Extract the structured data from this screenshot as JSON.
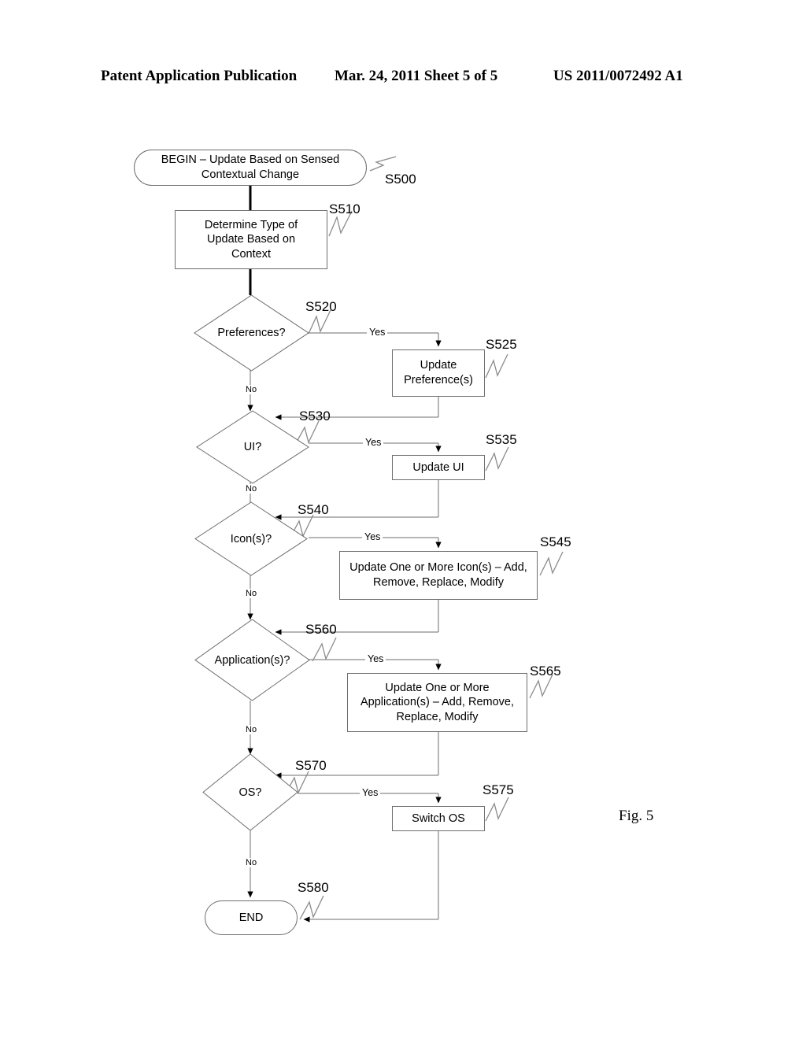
{
  "header": {
    "title": "Patent Application Publication",
    "date_sheet": "Mar. 24, 2011  Sheet 5 of 5",
    "publication_number": "US 2011/0072492 A1"
  },
  "figure": {
    "label": "Fig. 5"
  },
  "flowchart": {
    "nodes": {
      "begin": {
        "label": "BEGIN – Update Based on Sensed Contextual Change",
        "ref": "S500",
        "shape": "terminator"
      },
      "determine": {
        "label": "Determine Type of Update Based on Context",
        "ref": "S510",
        "shape": "process"
      },
      "preferences_decision": {
        "label": "Preferences?",
        "ref": "S520",
        "shape": "decision"
      },
      "update_preferences": {
        "label": "Update Preference(s)",
        "ref": "S525",
        "shape": "process"
      },
      "ui_decision": {
        "label": "UI?",
        "ref": "S530",
        "shape": "decision"
      },
      "update_ui": {
        "label": "Update UI",
        "ref": "S535",
        "shape": "process"
      },
      "icons_decision": {
        "label": "Icon(s)?",
        "ref": "S540",
        "shape": "decision"
      },
      "update_icons": {
        "label": "Update One or More Icon(s) – Add, Remove, Replace, Modify",
        "ref": "S545",
        "shape": "process"
      },
      "applications_decision": {
        "label": "Application(s)?",
        "ref": "S560",
        "shape": "decision"
      },
      "update_applications": {
        "label": "Update One or More Application(s) – Add, Remove, Replace, Modify",
        "ref": "S565",
        "shape": "process"
      },
      "os_decision": {
        "label": "OS?",
        "ref": "S570",
        "shape": "decision"
      },
      "switch_os": {
        "label": "Switch OS",
        "ref": "S575",
        "shape": "process"
      },
      "end": {
        "label": "END",
        "ref": "S580",
        "shape": "terminator"
      }
    },
    "edge_labels": {
      "pref_yes": "Yes",
      "pref_no": "No",
      "ui_yes": "Yes",
      "ui_no": "No",
      "icons_yes": "Yes",
      "icons_no": "No",
      "apps_yes": "Yes",
      "apps_no": "No",
      "os_yes": "Yes",
      "os_no": "No"
    }
  }
}
